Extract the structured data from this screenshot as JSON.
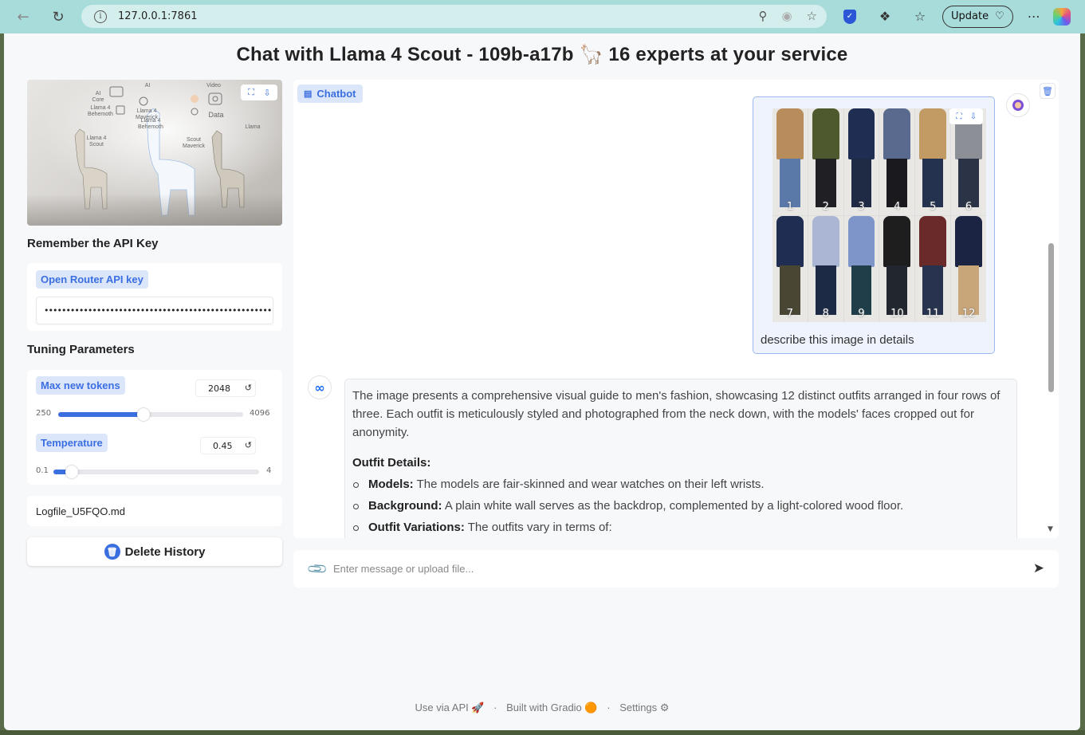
{
  "browser": {
    "url": "127.0.0.1:7861",
    "update_label": "Update"
  },
  "page_title": "Chat with Llama 4 Scout - 109b-a17b 🦙 16 experts at your service",
  "hero_labels": [
    "AI Core",
    "Llama 4 Behemoth",
    "AI",
    "Llama 4 Maverick",
    "Video",
    "Data",
    "Llama 4 Behemoth",
    "Llama 4 Scout",
    "Scout Maverick",
    "Llama"
  ],
  "api_section": {
    "heading": "Remember the API Key",
    "label": "Open Router API key",
    "value": "•••••••••••••••••••••••••••••••••••••••••••••••••••••••••••••••••••••••••"
  },
  "tuning": {
    "heading": "Tuning Parameters",
    "max_tokens": {
      "label": "Max new tokens",
      "value": "2048",
      "min": "250",
      "max": "4096",
      "fraction": 0.4616
    },
    "temperature": {
      "label": "Temperature",
      "value": "0.45",
      "min": "0.1",
      "max": "4",
      "fraction": 0.0897
    }
  },
  "logfile": "Logfile_U5FQO.md",
  "delete_label": "Delete History",
  "chatbot": {
    "label": "Chatbot",
    "user_message": "describe this image in details",
    "outfit_numbers": [
      "1",
      "2",
      "3",
      "4",
      "5",
      "6",
      "7",
      "8",
      "9",
      "10",
      "11",
      "12"
    ],
    "bot_intro": "The image presents a comprehensive visual guide to men's fashion, showcasing 12 distinct outfits arranged in four rows of three. Each outfit is meticulously styled and photographed from the neck down, with the models' faces cropped out for anonymity.",
    "bot_heading": "Outfit Details:",
    "bot_items": [
      {
        "term": "Models:",
        "text": " The models are fair-skinned and wear watches on their left wrists."
      },
      {
        "term": "Background:",
        "text": " A plain white wall serves as the backdrop, complemented by a light-colored wood floor."
      },
      {
        "term": "Outfit Variations:",
        "text": " The outfits vary in terms of:"
      }
    ]
  },
  "input": {
    "placeholder": "Enter message or upload file..."
  },
  "footer": {
    "api": "Use via API 🚀",
    "built": "Built with Gradio 🟠",
    "settings": "Settings ⚙"
  },
  "colors": {
    "accent": "#3b6fe0",
    "browser_bar": "#a8dcda"
  }
}
